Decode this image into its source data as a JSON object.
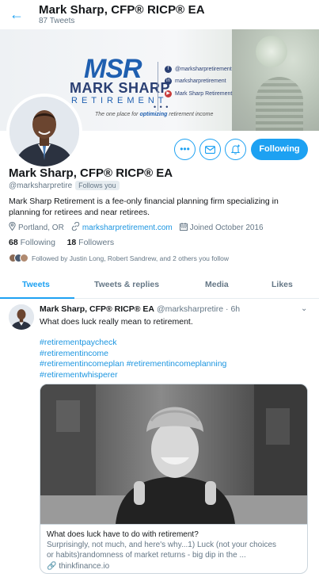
{
  "topbar": {
    "name": "Mark Sharp, CFP® RICP® EA",
    "tweet_count": "87 Tweets"
  },
  "banner": {
    "logo_initials": "MSR",
    "logo_name": "MARK SHARP",
    "logo_sub": "RETIREMENT",
    "social": [
      "@marksharpretirement",
      "marksharpretirement",
      "Mark Sharp Retirement"
    ],
    "dots": "• • •",
    "tagline_pre": "The one place for ",
    "tagline_bold": "optimizing",
    "tagline_post": " retirement income"
  },
  "actions": {
    "more_icon": "•••",
    "follow_label": "Following"
  },
  "profile": {
    "name": "Mark Sharp, CFP® RICP® EA",
    "handle": "@marksharpretire",
    "follows_you": "Follows you",
    "bio": "Mark Sharp Retirement is a fee-only financial planning firm specializing in planning for retirees and near retirees.",
    "location": "Portland, OR",
    "website": "marksharpretirement.com",
    "joined": "Joined October 2016",
    "following_count": "68",
    "following_label": "Following",
    "followers_count": "18",
    "followers_label": "Followers",
    "followed_by": "Followed by Justin Long, Robert Sandrew, and 2 others you follow"
  },
  "tabs": [
    "Tweets",
    "Tweets & replies",
    "Media",
    "Likes"
  ],
  "tweet": {
    "name": "Mark Sharp, CFP® RICP® EA",
    "handle_time": "@marksharpretire · 6h",
    "text": "What does luck really mean to retirement.",
    "hashtags": [
      "#retirementpaycheck",
      "#retirementincome",
      "#retirementincomeplan #retirementincomeplanning",
      "#retirementwhisperer"
    ],
    "card": {
      "title": "What does luck have to do with retirement?",
      "desc_line1": "Surprisingly, not much, and here's why...1) Luck (not your choices",
      "desc_line2": "or habits)randomness of market returns - big dip in the ...",
      "domain": "thinkfinance.io"
    }
  },
  "colors": {
    "accent": "#1da1f2",
    "link": "#1b95e0",
    "muted": "#657786",
    "text": "#14171a"
  }
}
